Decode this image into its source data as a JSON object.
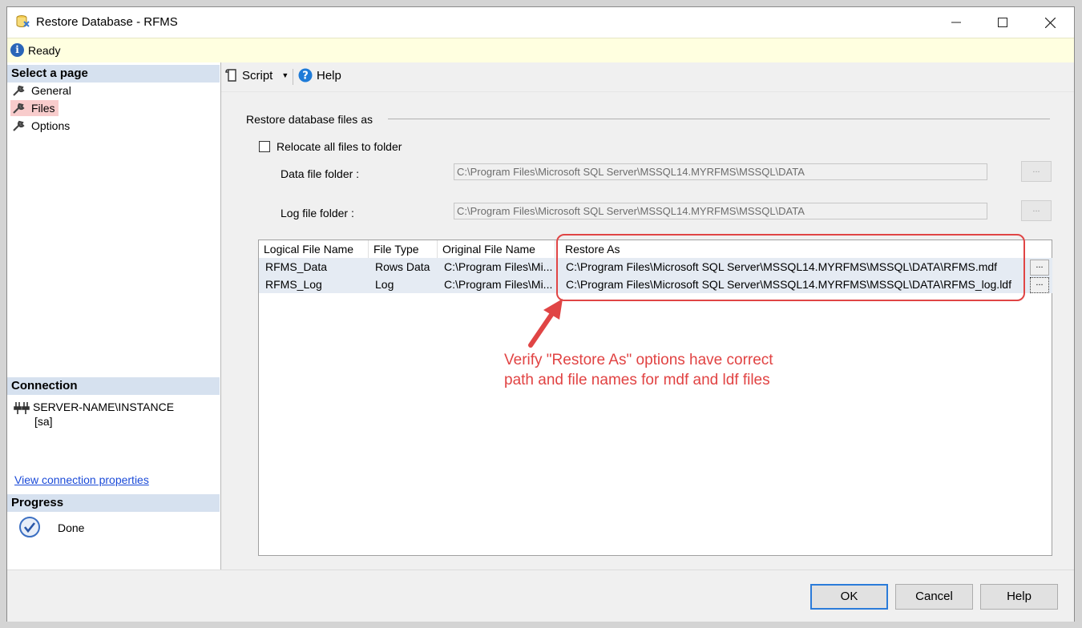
{
  "window": {
    "title": "Restore Database - RFMS"
  },
  "status": {
    "text": "Ready"
  },
  "left": {
    "select_page": "Select a page",
    "pages": [
      {
        "label": "General"
      },
      {
        "label": "Files"
      },
      {
        "label": "Options"
      }
    ],
    "connection_header": "Connection",
    "server": "SERVER-NAME\\INSTANCE",
    "login": "[sa]",
    "view_connection": "View connection properties",
    "progress_header": "Progress",
    "progress_status": "Done"
  },
  "toolbar": {
    "script_label": "Script",
    "help_label": "Help"
  },
  "form": {
    "section_title": "Restore database files as",
    "relocate_label": "Relocate all files to folder",
    "data_folder_label": "Data file folder :",
    "data_folder_value": "C:\\Program Files\\Microsoft SQL Server\\MSSQL14.MYRFMS\\MSSQL\\DATA",
    "log_folder_label": "Log file folder :",
    "log_folder_value": "C:\\Program Files\\Microsoft SQL Server\\MSSQL14.MYRFMS\\MSSQL\\DATA",
    "browse_label": "..."
  },
  "grid": {
    "columns": [
      "Logical File Name",
      "File Type",
      "Original File Name",
      "Restore As"
    ],
    "rows": [
      {
        "logical": "RFMS_Data",
        "type": "Rows Data",
        "original": "C:\\Program Files\\Mi...",
        "restore_as": "C:\\Program Files\\Microsoft SQL Server\\MSSQL14.MYRFMS\\MSSQL\\DATA\\RFMS.mdf"
      },
      {
        "logical": "RFMS_Log",
        "type": "Log",
        "original": "C:\\Program Files\\Mi...",
        "restore_as": "C:\\Program Files\\Microsoft SQL Server\\MSSQL14.MYRFMS\\MSSQL\\DATA\\RFMS_log.ldf"
      }
    ],
    "row_button_label": "..."
  },
  "annotation": {
    "line1": "Verify \"Restore As\" options have correct",
    "line2": "path and file names for mdf and ldf files"
  },
  "buttons": {
    "ok": "OK",
    "cancel": "Cancel",
    "help": "Help"
  },
  "colors": {
    "highlight": "#e04545",
    "header_band": "#d6e1ef",
    "status_bg": "#ffffe0"
  }
}
